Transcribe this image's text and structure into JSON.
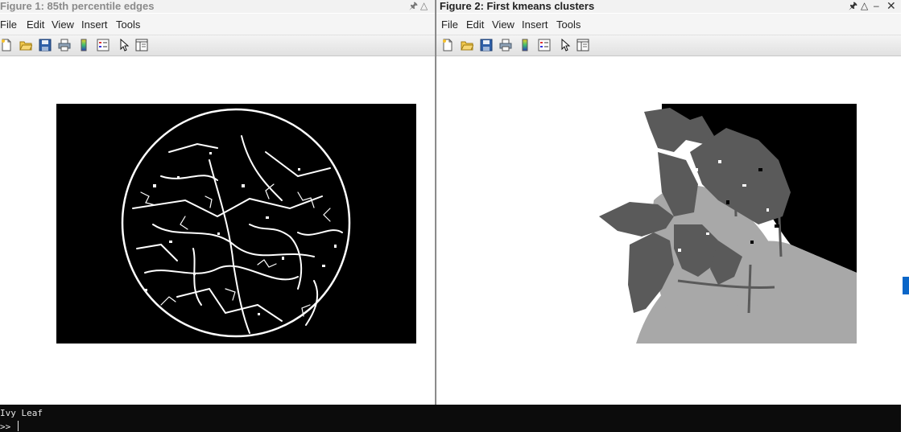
{
  "figures": [
    {
      "title": "Figure 1: 85th percentile edges",
      "menu": [
        "File",
        "Edit",
        "View",
        "Insert",
        "Tools"
      ],
      "toolbar_icons": [
        "new-figure-icon",
        "open-file-icon",
        "save-icon",
        "print-icon",
        "colorbar-icon",
        "legend-icon",
        "pointer-icon",
        "property-inspector-icon"
      ],
      "title_controls": [
        "pin-icon",
        "restore-icon"
      ],
      "image": "Binary edge map of circular leaf image (white edges on black)"
    },
    {
      "title": "Figure 2: First kmeans clusters",
      "menu": [
        "File",
        "Edit",
        "View",
        "Insert",
        "Tools"
      ],
      "toolbar_icons": [
        "new-figure-icon",
        "open-file-icon",
        "save-icon",
        "print-icon",
        "colorbar-icon",
        "legend-icon",
        "pointer-icon",
        "property-inspector-icon"
      ],
      "title_controls": [
        "pin-icon",
        "restore-icon",
        "minimize-icon",
        "close-icon"
      ],
      "image": "Grayscale kmeans cluster map of ivy leaf"
    }
  ],
  "console": {
    "output": "Ivy Leaf",
    "prompt": ">>"
  },
  "colors": {
    "window_bg": "#ffffff",
    "console_bg": "#0c0c0c",
    "cluster_dark": "#5a5a5a",
    "cluster_light": "#a8a8a8",
    "accent_blue": "#0a66c8"
  }
}
